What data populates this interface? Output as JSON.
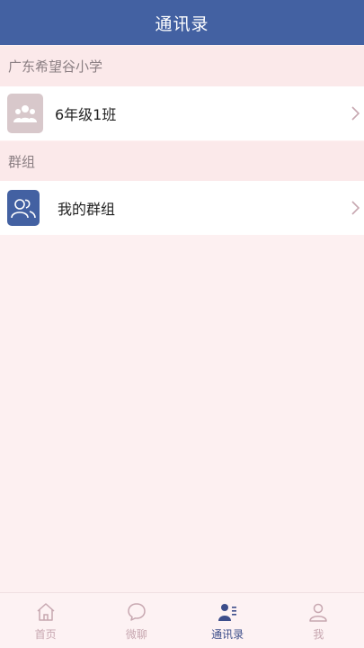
{
  "header": {
    "title": "通讯录"
  },
  "sections": [
    {
      "header": "广东希望谷小学",
      "items": [
        {
          "label": "6年级1班",
          "icon": "class-group-icon"
        }
      ]
    },
    {
      "header": "群组",
      "items": [
        {
          "label": "我的群组",
          "icon": "my-groups-icon"
        }
      ]
    }
  ],
  "nav": {
    "items": [
      {
        "label": "首页",
        "icon": "home-icon",
        "active": false
      },
      {
        "label": "微聊",
        "icon": "chat-bubble-icon",
        "active": false
      },
      {
        "label": "通讯录",
        "icon": "contacts-icon",
        "active": true
      },
      {
        "label": "我",
        "icon": "person-icon",
        "active": false
      }
    ]
  },
  "colors": {
    "header_bg": "#4361a2",
    "page_bg": "#fdf0f1",
    "section_bg": "#fbe9ea",
    "active_nav": "#3c4d8a",
    "inactive_nav": "#c7a7b0"
  }
}
